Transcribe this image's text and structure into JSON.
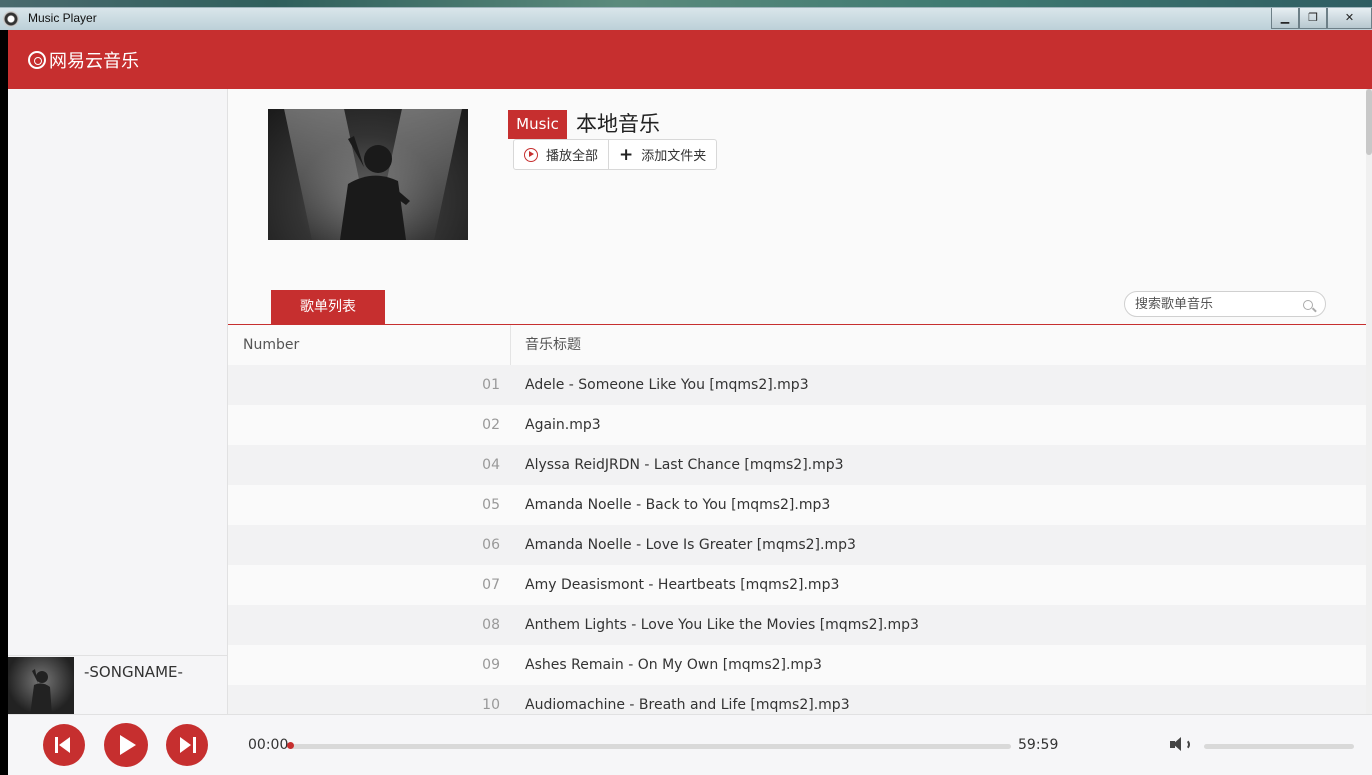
{
  "window": {
    "title": "Music Player",
    "buttons": {
      "minimize": "▁",
      "restore": "❐",
      "close": "✕"
    }
  },
  "header": {
    "logo_text": "网易云音乐"
  },
  "album": {
    "badge": "Music",
    "title": "本地音乐",
    "play_all_label": "播放全部",
    "add_folder_label": "添加文件夹"
  },
  "tabs": {
    "active_label": "歌单列表"
  },
  "search": {
    "placeholder": "搜索歌单音乐"
  },
  "table": {
    "columns": [
      "Number",
      "音乐标题"
    ],
    "rows": [
      {
        "num": "01",
        "title": "Adele - Someone Like You [mqms2].mp3"
      },
      {
        "num": "02",
        "title": "Again.mp3"
      },
      {
        "num": "04",
        "title": "Alyssa ReidJRDN - Last Chance [mqms2].mp3"
      },
      {
        "num": "05",
        "title": "Amanda Noelle - Back to You [mqms2].mp3"
      },
      {
        "num": "06",
        "title": "Amanda Noelle - Love Is Greater [mqms2].mp3"
      },
      {
        "num": "07",
        "title": "Amy Deasismont - Heartbeats [mqms2].mp3"
      },
      {
        "num": "08",
        "title": "Anthem Lights - Love You Like the Movies [mqms2].mp3"
      },
      {
        "num": "09",
        "title": "Ashes Remain - On My Own [mqms2].mp3"
      },
      {
        "num": "10",
        "title": "Audiomachine - Breath and Life [mqms2].mp3"
      }
    ]
  },
  "now_playing": {
    "song_name": "-SONGNAME-"
  },
  "player": {
    "current_time": "00:00",
    "total_time": "59:59",
    "progress": 0,
    "volume": 0
  },
  "colors": {
    "accent": "#c62f2f"
  }
}
